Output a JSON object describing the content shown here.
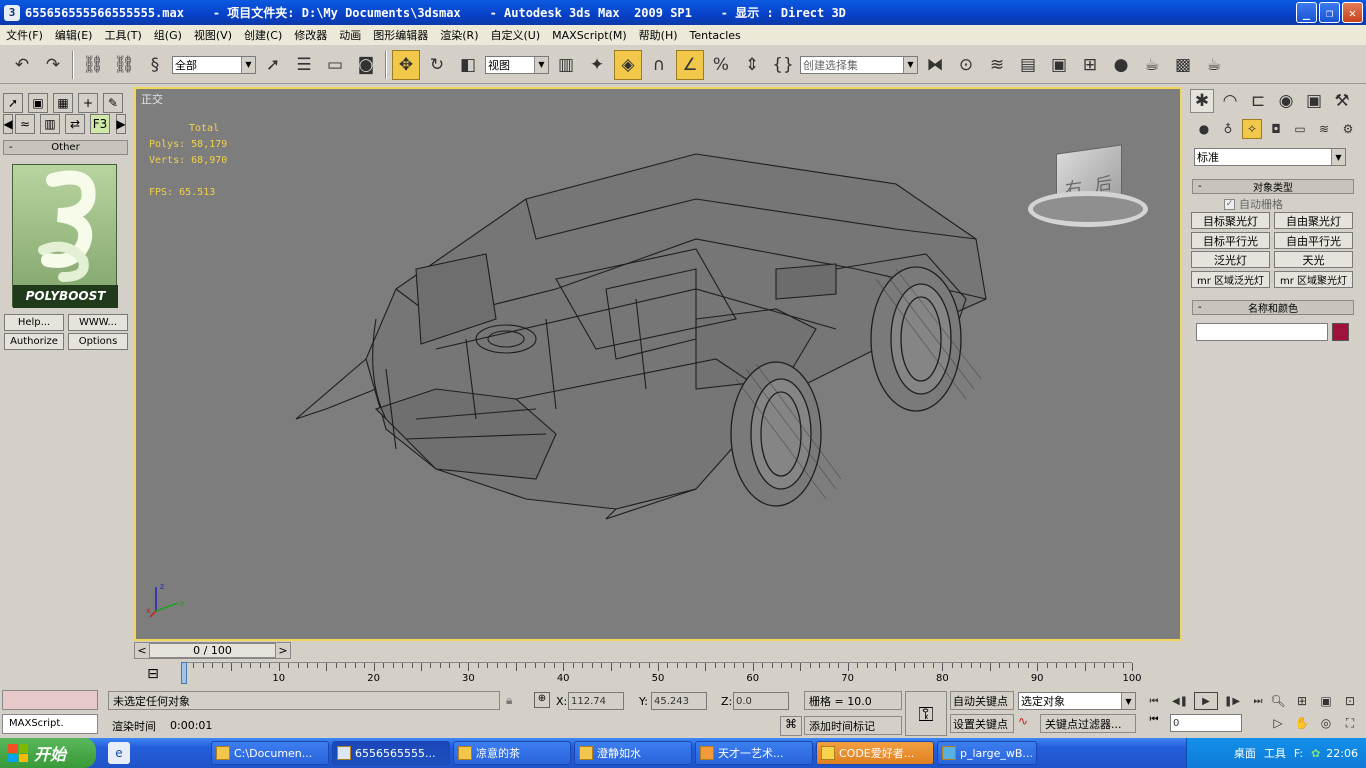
{
  "window": {
    "title": "655656555566555555.max    - 项目文件夹: D:\\My Documents\\3dsmax    - Autodesk 3ds Max  2009 SP1    - 显示 : Direct 3D"
  },
  "menu": [
    "文件(F)",
    "编辑(E)",
    "工具(T)",
    "组(G)",
    "视图(V)",
    "创建(C)",
    "修改器",
    "动画",
    "图形编辑器",
    "渲染(R)",
    "自定义(U)",
    "MAXScript(M)",
    "帮助(H)",
    "Tentacles"
  ],
  "toolbar": {
    "selection_filter": "全部",
    "ref_coord": "视图",
    "named_selection_placeholder": "创建选择集"
  },
  "left_panel": {
    "rollup_title": "Other",
    "logo_text": "POLYBOOST",
    "help_label": "Help...",
    "www_label": "WWW...",
    "authorize_label": "Authorize",
    "options_label": "Options"
  },
  "viewport": {
    "label": "正交",
    "stats": {
      "total_label": "Total",
      "polys_label": "Polys:",
      "polys": "58,179",
      "verts_label": "Verts:",
      "verts": "68,970",
      "fps_label": "FPS:",
      "fps": "65.513"
    },
    "viewcube_left": "右",
    "viewcube_right": "后"
  },
  "command_panel": {
    "category": "标准",
    "object_type_title": "对象类型",
    "autogrid_label": "自动栅格",
    "buttons": [
      "目标聚光灯",
      "自由聚光灯",
      "目标平行光",
      "自由平行光",
      "泛光灯",
      "天光",
      "mr 区域泛光灯",
      "mr 区域聚光灯"
    ],
    "name_color_title": "名称和颜色",
    "color": "#a0123c"
  },
  "timeline": {
    "frame_display": "0 / 100",
    "ticks": [
      "0",
      "10",
      "20",
      "30",
      "40",
      "50",
      "60",
      "70",
      "80",
      "90",
      "100"
    ],
    "frame_progress": 0.0
  },
  "status": {
    "maxscript_label": "MAXScript.",
    "selection_message": "未选定任何对象",
    "render_time_label": "渲染时间",
    "render_time": "0:00:01",
    "x_label": "X:",
    "x_value": "112.74",
    "y_label": "Y:",
    "y_value": "45.243",
    "z_label": "Z:",
    "z_value": "0.0",
    "grid_label": "栅格 = 10.0",
    "add_time_tag": "添加时间标记",
    "auto_key": "自动关键点",
    "set_key": "设置关键点",
    "key_target": "选定对象",
    "key_filters": "关键点过滤器...",
    "frame_field": "0"
  },
  "taskbar": {
    "start_label": "开始",
    "tasks": [
      "C:\\Documen...",
      "6556565555...",
      "凉意的茶",
      "澄静如水",
      "天才一艺术...",
      "CODE爱好者...",
      "p_large_wB..."
    ],
    "tray_desktop": "桌面",
    "tray_tools": "工具",
    "tray_f": "F:",
    "clock": "22:06"
  }
}
